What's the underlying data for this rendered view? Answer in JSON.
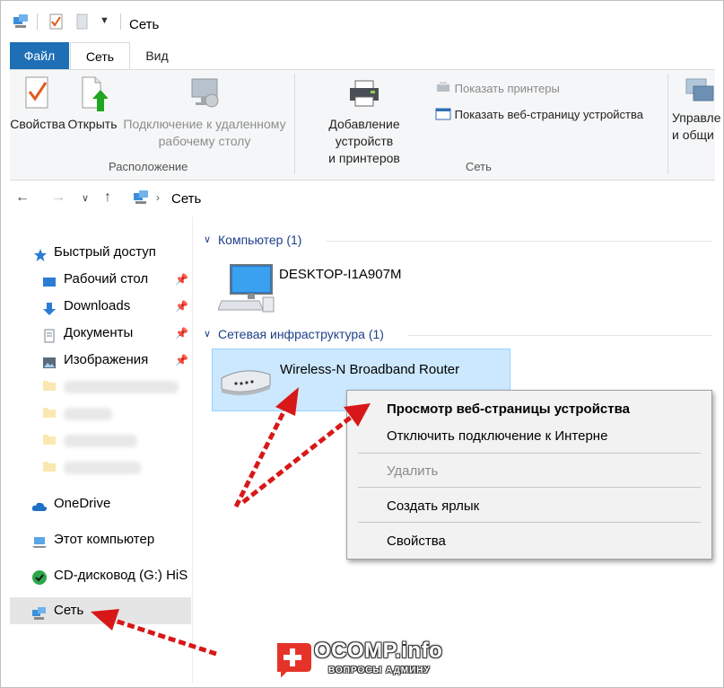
{
  "window": {
    "title": "Сеть"
  },
  "ribbon": {
    "tabs": [
      {
        "label": "Файл"
      },
      {
        "label": "Сеть"
      },
      {
        "label": "Вид"
      }
    ],
    "buttons": {
      "properties": "Свойства",
      "open": "Открыть",
      "remote_desktop_line1": "Подключение к удаленному",
      "remote_desktop_line2": "рабочему столу",
      "add_devices_line1": "Добавление устройств",
      "add_devices_line2": "и принтеров",
      "show_printers": "Показать принтеры",
      "show_device_webpage": "Показать веб-страницу устройства",
      "manage_line1": "Управле",
      "manage_line2": "и общи"
    },
    "groups": {
      "location": "Расположение",
      "network": "Сеть"
    }
  },
  "address": {
    "path": "Сеть"
  },
  "nav_pane": {
    "quick_access": "Быстрый доступ",
    "items": [
      {
        "label": "Рабочий стол"
      },
      {
        "label": "Downloads"
      },
      {
        "label": "Документы"
      },
      {
        "label": "Изображения"
      }
    ],
    "onedrive": "OneDrive",
    "this_pc": "Этот компьютер",
    "cd_drive": "CD-дисковод (G:) HiS",
    "network": "Сеть"
  },
  "content": {
    "groups": [
      {
        "header": "Компьютер (1)",
        "items": [
          {
            "name": "DESKTOP-I1A907M"
          }
        ]
      },
      {
        "header": "Сетевая инфраструктура (1)",
        "items": [
          {
            "name": "Wireless-N Broadband Router"
          }
        ]
      }
    ]
  },
  "context_menu": {
    "items": [
      {
        "label": "Просмотр веб-страницы устройства",
        "state": "default"
      },
      {
        "label": "Отключить подключение к Интерне",
        "state": "normal"
      },
      {
        "label": "Удалить",
        "state": "disabled"
      },
      {
        "label": "Создать ярлык",
        "state": "normal"
      },
      {
        "label": "Свойства",
        "state": "normal"
      }
    ]
  },
  "watermark": {
    "title": "OCOMP.info",
    "subtitle": "ВОПРОСЫ АДМИНУ"
  },
  "colors": {
    "accent": "#1e6fb6",
    "selection": "#cce8ff",
    "group_header": "#1e3f8a",
    "annotation_arrow": "#e02020"
  }
}
